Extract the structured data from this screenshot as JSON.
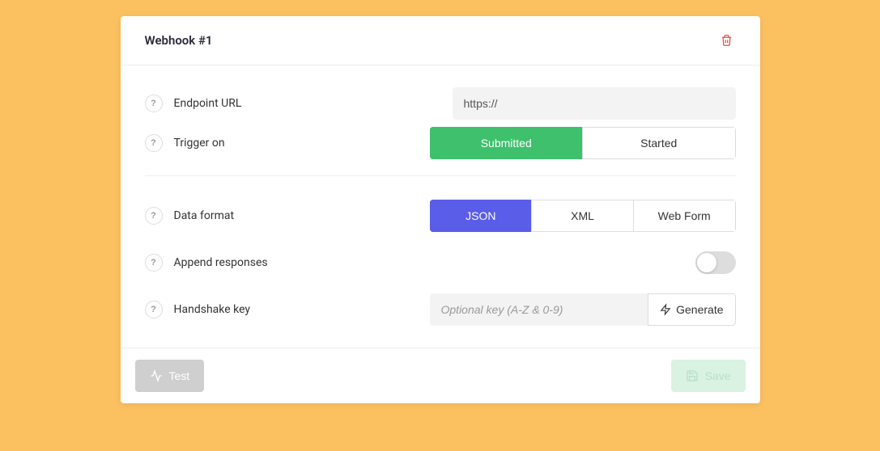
{
  "header": {
    "title": "Webhook #1"
  },
  "fields": {
    "endpoint": {
      "label": "Endpoint URL",
      "value": "https://"
    },
    "trigger": {
      "label": "Trigger on",
      "options": [
        "Submitted",
        "Started"
      ],
      "selected": "Submitted"
    },
    "format": {
      "label": "Data format",
      "options": [
        "JSON",
        "XML",
        "Web Form"
      ],
      "selected": "JSON"
    },
    "append": {
      "label": "Append responses",
      "value": false
    },
    "handshake": {
      "label": "Handshake key",
      "placeholder": "Optional key (A-Z & 0-9)",
      "generate_label": "Generate"
    }
  },
  "footer": {
    "test_label": "Test",
    "save_label": "Save"
  },
  "help_glyph": "?"
}
